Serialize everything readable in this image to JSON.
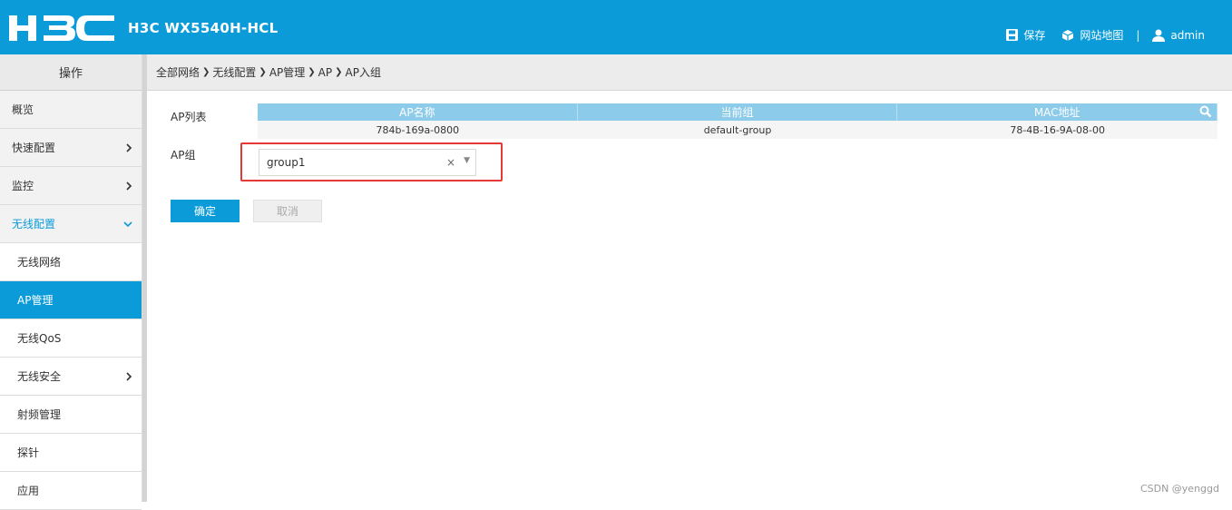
{
  "header": {
    "logo_text": "H3C",
    "title": "H3C WX5540H-HCL",
    "save_label": "保存",
    "sitemap_label": "网站地图",
    "separator": "|",
    "user_label": "admin"
  },
  "sidebar": {
    "heading": "操作",
    "items": [
      {
        "label": "概览"
      },
      {
        "label": "快速配置"
      },
      {
        "label": "监控"
      },
      {
        "label": "无线配置"
      }
    ],
    "subitems": [
      {
        "label": "无线网络"
      },
      {
        "label": "AP管理"
      },
      {
        "label": "无线QoS"
      },
      {
        "label": "无线安全"
      },
      {
        "label": "射频管理"
      },
      {
        "label": "探针"
      },
      {
        "label": "应用"
      }
    ]
  },
  "breadcrumb": [
    "全部网络",
    "无线配置",
    "AP管理",
    "AP",
    "AP入组"
  ],
  "form": {
    "ap_list_label": "AP列表",
    "ap_group_label": "AP组",
    "table": {
      "columns": [
        "AP名称",
        "当前组",
        "MAC地址"
      ],
      "rows": [
        [
          "784b-169a-0800",
          "default-group",
          "78-4B-16-9A-08-00"
        ]
      ]
    },
    "group_value": "group1",
    "clear_glyph": "×",
    "arrow_glyph": "▼",
    "ok_label": "确定",
    "cancel_label": "取消"
  },
  "watermark": "CSDN @yenggd",
  "colors": {
    "brand": "#0a9bd8",
    "highlight_border": "#e53935"
  }
}
